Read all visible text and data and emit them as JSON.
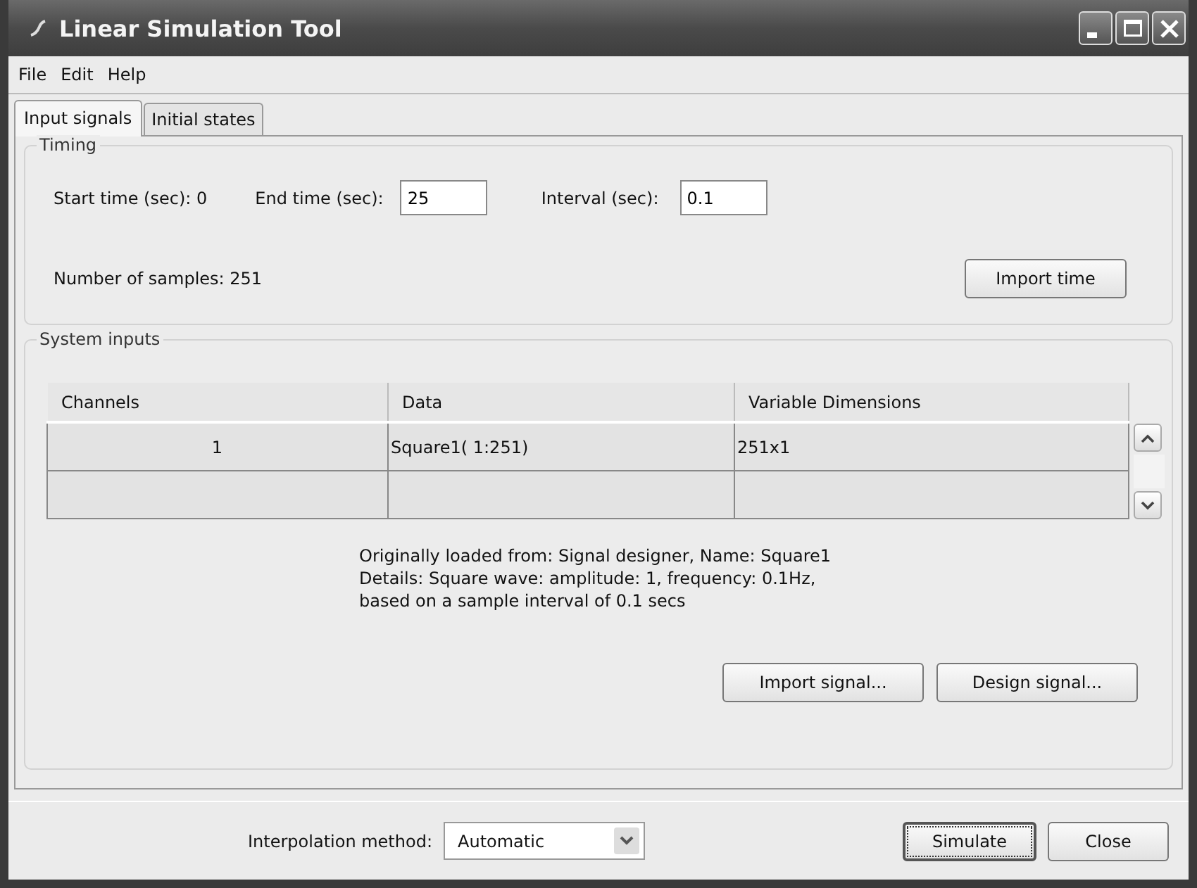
{
  "window": {
    "title": "Linear Simulation Tool"
  },
  "menu": [
    "File",
    "Edit",
    "Help"
  ],
  "tabs": [
    {
      "label": "Input signals",
      "selected": true
    },
    {
      "label": "Initial states",
      "selected": false
    }
  ],
  "timing": {
    "title": "Timing",
    "start_time": "Start time (sec): 0",
    "end_time": {
      "label": "End time (sec):",
      "value": "25"
    },
    "interval": {
      "label": "Interval (sec):",
      "value": "0.1"
    },
    "samples": "Number of samples: 251",
    "import_button": "Import time"
  },
  "system_inputs": {
    "title": "System inputs",
    "table": {
      "columns": [
        "Channels",
        "Data",
        "Variable Dimensions"
      ],
      "rows": [
        {
          "cells": [
            "1",
            "Square1( 1:251)",
            "251x1"
          ]
        }
      ]
    },
    "info": [
      "Originally loaded from:  Signal designer, Name: Square1",
      "Details:  Square wave: amplitude: 1, frequency: 0.1Hz,",
      "based on a sample interval of 0.1 secs"
    ],
    "buttons": [
      "Import signal...",
      "Design signal..."
    ]
  },
  "interpolation": {
    "label": "Interpolation method:",
    "value": "Automatic"
  },
  "actions": [
    {
      "label": "Simulate",
      "default": true
    },
    {
      "label": "Close",
      "default": false
    }
  ]
}
